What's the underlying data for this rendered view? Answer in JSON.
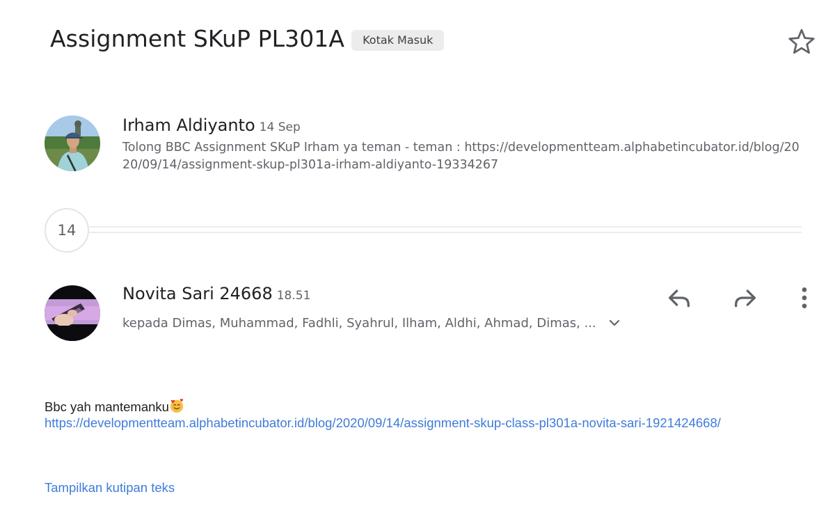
{
  "thread": {
    "subject": "Assignment SKuP PL301A",
    "label": "Kotak Masuk",
    "star_icon": "star-outline-icon"
  },
  "message1": {
    "sender": "Irham Aldiyanto",
    "date": "14 Sep",
    "snippet": "Tolong BBC Assignment SKuP Irham ya teman - teman : https://developmentteam.alphabetincubator.id/blog/2020/09/14/assignment-skup-pl301a-irham-aldiyanto-19334267",
    "avatar_icon": "profile-photo"
  },
  "collapsed": {
    "count": "14"
  },
  "message2": {
    "sender": "Novita Sari 24668",
    "time": "18.51",
    "recipients": "kepada Dimas, Muhammad, Fadhli, Syahrul, Ilham, Aldhi, Ahmad, Dimas, ...",
    "avatar_icon": "profile-photo",
    "actions": {
      "reply_icon": "reply-icon",
      "forward_icon": "forward-icon",
      "more_icon": "more-vert-icon"
    },
    "body_text": "Bbc yah mantemanku",
    "link": "https://developmentteam.alphabetincubator.id/blog/2020/09/14/assignment-skup-class-pl301a-novita-sari-1921424668/",
    "quote_toggle": "Tampilkan kutipan teks"
  },
  "colors": {
    "link": "#3f7bdb",
    "chip_bg": "#ececec",
    "secondary_text": "#5f6368"
  }
}
